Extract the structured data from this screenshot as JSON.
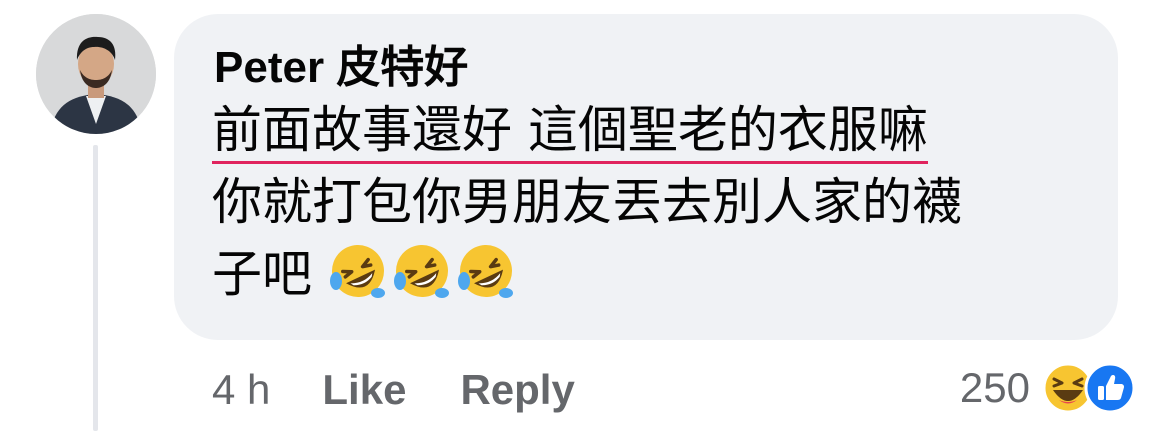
{
  "comment": {
    "author": "Peter 皮特好",
    "text_lines": [
      {
        "underlined": "前面故事還好 這個聖老的衣服嘛"
      },
      {
        "plain": "你就打包你男朋友丟去別人家的襪"
      },
      {
        "plain": "子吧"
      }
    ],
    "emoji_name": "rolling-on-floor-laughing",
    "emoji_count": 3
  },
  "meta": {
    "time": "4 h",
    "like_label": "Like",
    "reply_label": "Reply"
  },
  "reactions": {
    "count": "250",
    "icons": [
      "haha-icon",
      "like-icon"
    ]
  },
  "colors": {
    "bubble": "#f0f2f5",
    "underline": "#e0245e",
    "meta_text": "#65676b",
    "like_blue": "#1877f2"
  }
}
